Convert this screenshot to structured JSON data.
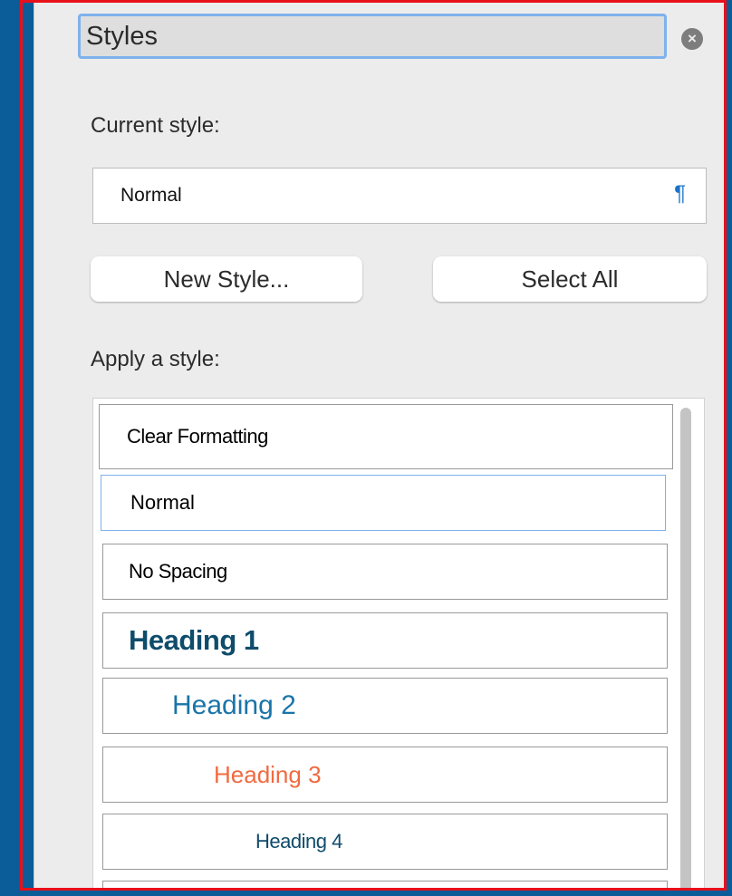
{
  "panel": {
    "title": "Styles",
    "close_icon": "×"
  },
  "current_style": {
    "label": "Current style:",
    "value": "Normal",
    "mark_icon": "¶"
  },
  "buttons": {
    "new_style": "New Style...",
    "select_all": "Select All"
  },
  "apply": {
    "label": "Apply a style:"
  },
  "styles": [
    {
      "label": "Clear Formatting",
      "color": "#111111"
    },
    {
      "label": "Normal",
      "color": "#111111"
    },
    {
      "label": "No Spacing",
      "color": "#111111"
    },
    {
      "label": "Heading 1",
      "color": "#0f4c6b"
    },
    {
      "label": "Heading 2",
      "color": "#1a74a8"
    },
    {
      "label": "Heading 3",
      "color": "#f06a40"
    },
    {
      "label": "Heading 4",
      "color": "#0f4c6b"
    },
    {
      "label": "",
      "color": "#111111"
    }
  ],
  "colors": {
    "accent": "#7fb1ec",
    "outer": "#0a5d98",
    "frame": "#e8101a"
  }
}
